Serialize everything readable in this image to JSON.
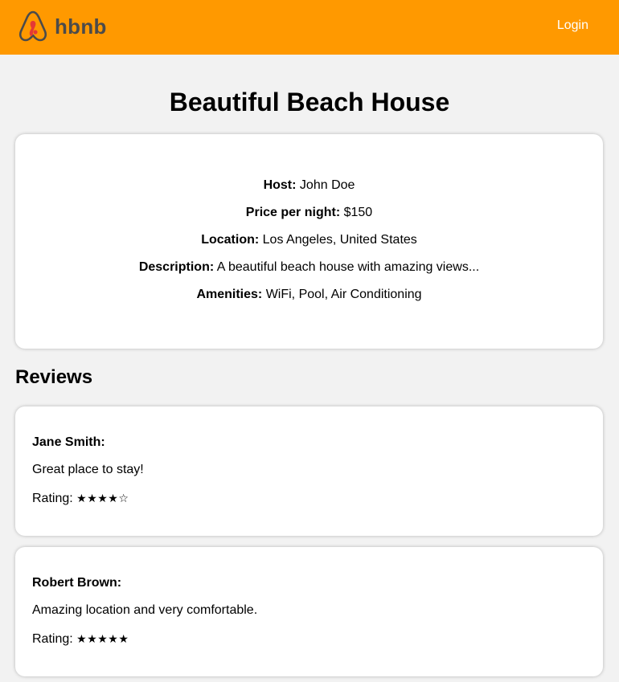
{
  "header": {
    "logo_text": "hbnb",
    "login_label": "Login",
    "background_color": "#ff9900",
    "logo_icon": "hbnb-logo-icon"
  },
  "place": {
    "title": "Beautiful Beach House",
    "host_label": "Host:",
    "host_value": "John Doe",
    "price_label": "Price per night:",
    "price_value": "$150",
    "location_label": "Location:",
    "location_value": "Los Angeles, United States",
    "description_label": "Description:",
    "description_value": "A beautiful beach house with amazing views...",
    "amenities_label": "Amenities:",
    "amenities_value": "WiFi, Pool, Air Conditioning"
  },
  "reviews": {
    "heading": "Reviews",
    "items": [
      {
        "author": "Jane Smith:",
        "text": "Great place to stay!",
        "rating_label": "Rating:",
        "rating_stars": "★★★★☆"
      },
      {
        "author": "Robert Brown:",
        "text": "Amazing location and very comfortable.",
        "rating_label": "Rating:",
        "rating_stars": "★★★★★"
      }
    ]
  }
}
